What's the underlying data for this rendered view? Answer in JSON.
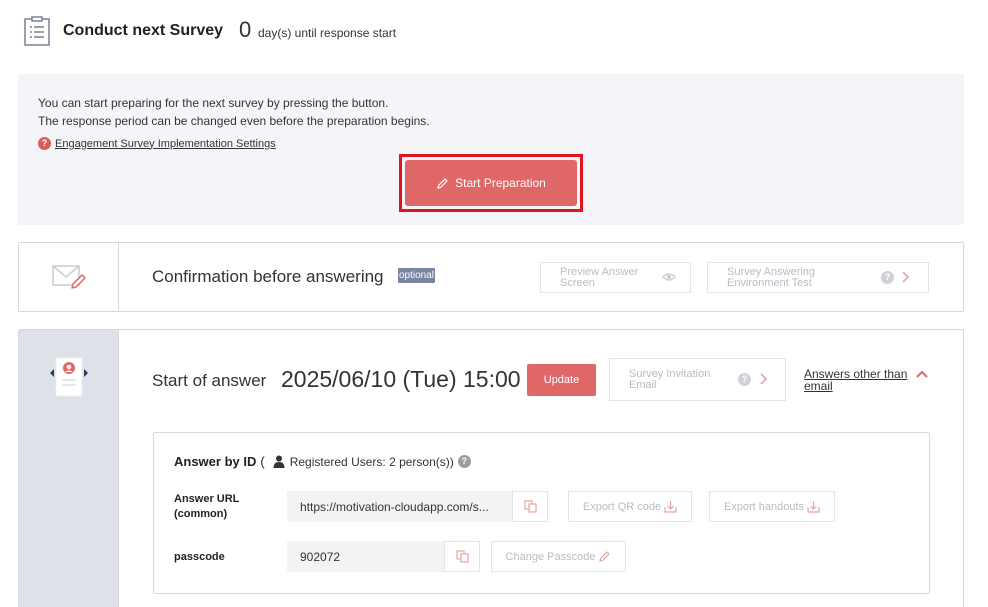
{
  "header": {
    "title": "Conduct next Survey",
    "days_count": "0",
    "days_text": "day(s) until response start"
  },
  "prep": {
    "line1": "You can start preparing for the next survey by pressing the button.",
    "line2": "The response period can be changed even before the preparation begins.",
    "help_icon": "?",
    "help_link": "Engagement Survey Implementation Settings",
    "start_button": "Start Preparation"
  },
  "confirm": {
    "heading": "Confirmation before answering",
    "badge": "optional",
    "preview_btn": [
      "Preview Answer",
      "Screen"
    ],
    "env_btn": [
      "Survey Answering",
      "Environment Test"
    ],
    "help_icon": "?"
  },
  "answer": {
    "heading": "Start of answer",
    "datetime": "2025/06/10 (Tue) 15:00",
    "update_btn": "Update",
    "invite_btn": [
      "Survey Invitation",
      "Email"
    ],
    "help_icon": "?",
    "other_link": [
      "Answers other than",
      "email"
    ]
  },
  "answer_by_id": {
    "title": "Answer by ID",
    "open_paren": "(",
    "registered": "Registered Users: 2 person(s))",
    "help_icon": "?",
    "url_label": [
      "Answer URL",
      "(common)"
    ],
    "url_value": "https://motivation-cloudapp.com/s...",
    "export_qr": "Export QR code",
    "export_handouts": "Export handouts",
    "passcode_label": "passcode",
    "passcode_value": "902072",
    "change_passcode": "Change Passcode"
  },
  "colors": {
    "accent": "#e06767",
    "highlight": "#e0141e",
    "badge": "#7b84a3"
  }
}
